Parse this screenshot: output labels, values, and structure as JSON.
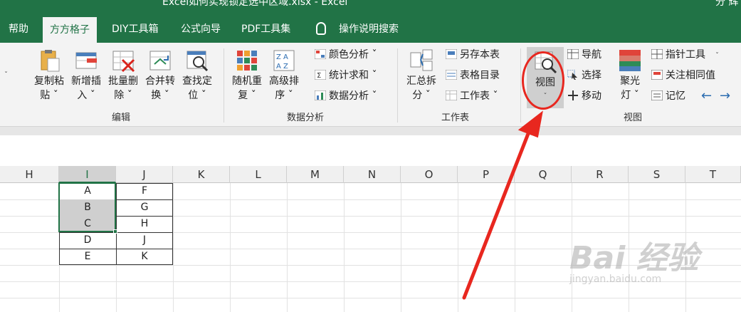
{
  "window": {
    "title": "Excel如何实现锁定选中区域.xlsx - Excel",
    "user": "分 辉"
  },
  "tabs": [
    {
      "label": "帮助"
    },
    {
      "label": "方方格子"
    },
    {
      "label": "DIY工具箱"
    },
    {
      "label": "公式向导"
    },
    {
      "label": "PDF工具集"
    },
    {
      "label": "操作说明搜索"
    }
  ],
  "ribbon": {
    "edit": {
      "group_label": "编辑",
      "buttons": [
        {
          "line1": "复制粘",
          "line2": "贴 ˇ"
        },
        {
          "line1": "新增插",
          "line2": "入 ˇ"
        },
        {
          "line1": "批量删",
          "line2": "除 ˇ"
        },
        {
          "line1": "合并转",
          "line2": "换 ˇ"
        },
        {
          "line1": "查找定",
          "line2": "位 ˇ"
        }
      ]
    },
    "analysis": {
      "group_label": "数据分析",
      "buttons": [
        {
          "line1": "随机重",
          "line2": "复 ˇ"
        },
        {
          "line1": "高级排",
          "line2": "序 ˇ"
        }
      ],
      "small": [
        "颜色分析 ˇ",
        "统计求和 ˇ",
        "数据分析 ˇ"
      ]
    },
    "sheet": {
      "group_label": "工作表",
      "buttons": [
        {
          "line1": "汇总拆",
          "line2": "分 ˇ"
        }
      ],
      "small": [
        "另存本表",
        "表格目录",
        "工作表 ˇ"
      ]
    },
    "view": {
      "group_label": "视图",
      "view_button": {
        "line1": "视图",
        "line2": "ˇ"
      },
      "small": [
        "导航",
        "选择",
        "移动"
      ],
      "spotlight": {
        "line1": "聚光",
        "line2": "灯 ˇ"
      },
      "small2": [
        "指针工具",
        "关注相同值",
        "记忆"
      ]
    }
  },
  "sheet": {
    "columns": [
      "H",
      "I",
      "J",
      "K",
      "L",
      "M",
      "N",
      "O",
      "P",
      "Q",
      "R",
      "S",
      "T"
    ],
    "selected_column": "I",
    "rows": [
      {
        "i": "A",
        "j": "F"
      },
      {
        "i": "B",
        "j": "G"
      },
      {
        "i": "C",
        "j": "H"
      },
      {
        "i": "D",
        "j": "J"
      },
      {
        "i": "E",
        "j": "K"
      }
    ]
  },
  "watermark": {
    "brand": "Bai 经验",
    "url": "jingyan.baidu.com"
  },
  "colors": {
    "excel_green": "#217346",
    "annotation_red": "#e8271f",
    "selection_gray": "#cfcfcf"
  }
}
